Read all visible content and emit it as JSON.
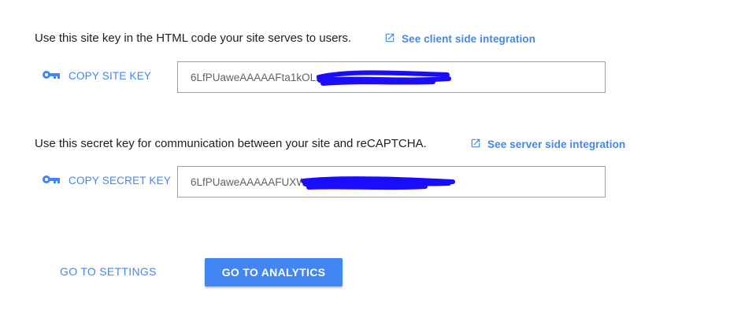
{
  "site_key_section": {
    "description": "Use this site key in the HTML code your site serves to users.",
    "link_label": "See client side integration",
    "copy_label": "COPY SITE KEY",
    "key_value": "6LfPUaweAAAAAFta1kOLn"
  },
  "secret_key_section": {
    "description": "Use this secret key for communication between your site and reCAPTCHA.",
    "link_label": "See server side integration",
    "copy_label": "COPY SECRET KEY",
    "key_value": "6LfPUaweAAAAAFUXW"
  },
  "actions": {
    "settings_label": "GO TO SETTINGS",
    "analytics_label": "GO TO ANALYTICS"
  },
  "colors": {
    "accent": "#4285f4",
    "redaction": "#1a0dff"
  }
}
